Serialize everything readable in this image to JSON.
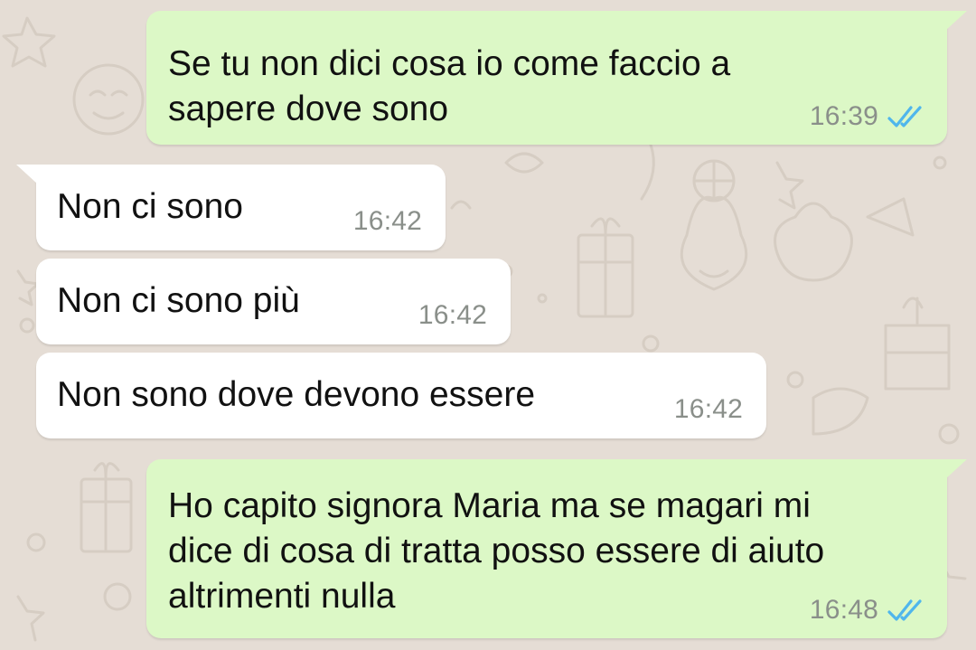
{
  "theme": {
    "wallpaper": "#e5ddd5",
    "outgoing_bubble": "#dcf8c6",
    "incoming_bubble": "#ffffff",
    "read_ticks": "#4fb6ec",
    "time_text": "#8a8f8a"
  },
  "messages": [
    {
      "direction": "outgoing",
      "text": "Se tu non dici cosa io come faccio a\nsapere dove sono",
      "time": "16:39",
      "status_icon": "double-check-read-icon"
    },
    {
      "direction": "incoming",
      "text": "Non ci sono",
      "time": "16:42"
    },
    {
      "direction": "incoming",
      "text": "Non ci sono più",
      "time": "16:42"
    },
    {
      "direction": "incoming",
      "text": "Non sono dove devono essere",
      "time": "16:42"
    },
    {
      "direction": "outgoing",
      "text": "Ho capito signora Maria ma se magari mi\ndice di cosa di tratta posso essere di aiuto\naltrimenti nulla",
      "time": "16:48",
      "status_icon": "double-check-read-icon"
    }
  ]
}
